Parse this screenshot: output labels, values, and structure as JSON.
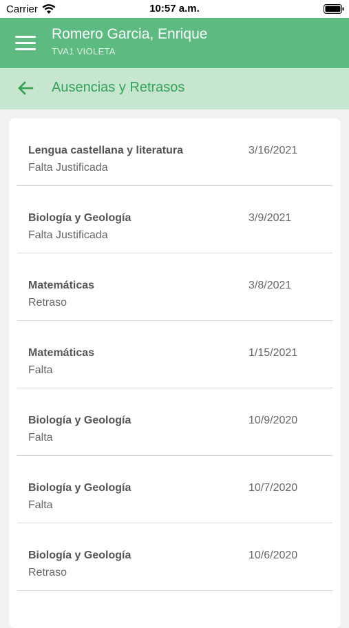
{
  "status_bar": {
    "carrier": "Carrier",
    "time": "10:57 a.m.",
    "wifi_icon": "wifi-icon",
    "battery_icon": "battery-icon"
  },
  "header": {
    "menu_icon": "hamburger-menu-icon",
    "student_name": "Romero Garcia, Enrique",
    "group": "TVA1 VIOLETA",
    "background_color": "#5dbb81"
  },
  "section": {
    "back_icon": "arrow-left-icon",
    "title": "Ausencias y Retrasos",
    "background_color": "#c6e6cf",
    "accent_color": "#35a25a"
  },
  "absences": [
    {
      "subject": "Lengua castellana y literatura",
      "type": "Falta Justificada",
      "date": "3/16/2021"
    },
    {
      "subject": "Biología y Geología",
      "type": "Falta Justificada",
      "date": "3/9/2021"
    },
    {
      "subject": "Matemáticas",
      "type": "Retraso",
      "date": "3/8/2021"
    },
    {
      "subject": "Matemáticas",
      "type": "Falta",
      "date": "1/15/2021"
    },
    {
      "subject": "Biología y Geología",
      "type": "Falta",
      "date": "10/9/2020"
    },
    {
      "subject": "Biología y Geología",
      "type": "Falta",
      "date": "10/7/2020"
    },
    {
      "subject": "Biología y Geología",
      "type": "Retraso",
      "date": "10/6/2020"
    }
  ]
}
